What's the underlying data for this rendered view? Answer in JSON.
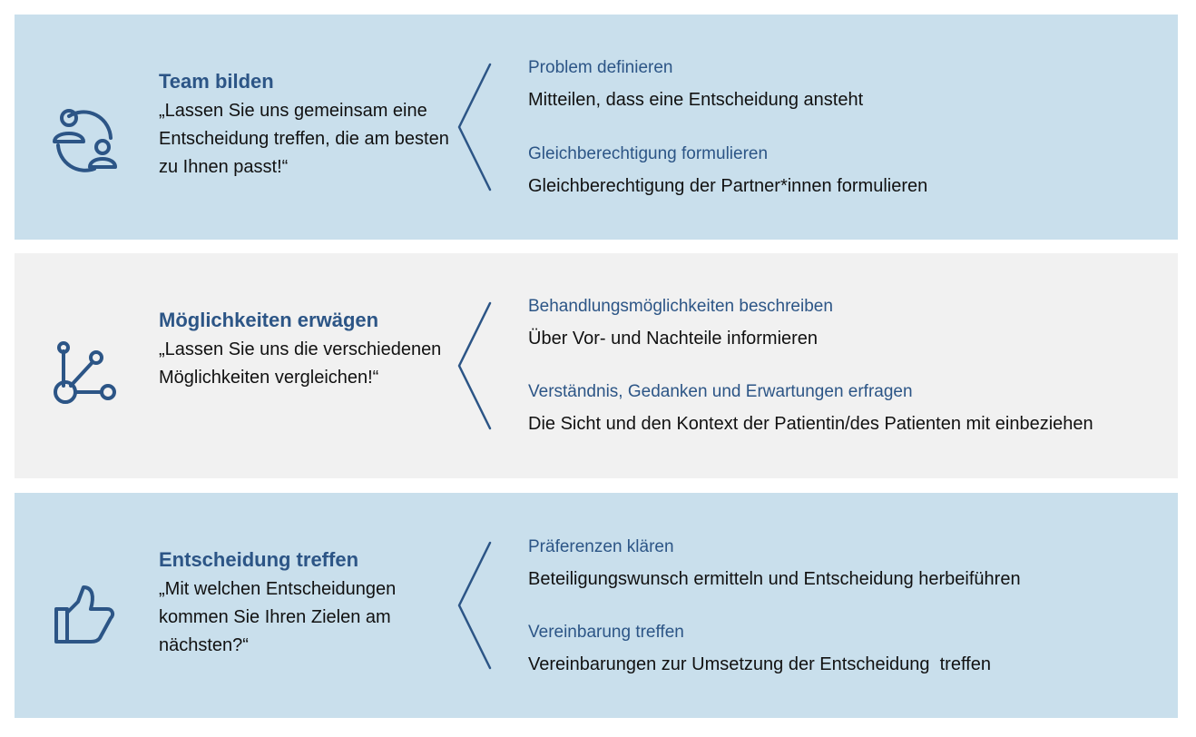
{
  "colors": {
    "panel_blue": "#c9dfec",
    "panel_gray": "#f1f1f1",
    "accent_navy": "#2c5586",
    "body_text": "#111111"
  },
  "sections": [
    {
      "icon": "team-people-icon",
      "title": "Team bilden",
      "quote": "„Lassen Sie uns gemeinsam eine Entscheidung treffen, die am besten zu Ihnen passt!“",
      "items": [
        {
          "heading": "Problem definieren",
          "description": "Mitteilen, dass eine Entscheidung ansteht"
        },
        {
          "heading": "Gleichberechtigung formulieren",
          "description": "Gleichberechtigung der Partner*innen formulieren"
        }
      ]
    },
    {
      "icon": "branching-nodes-icon",
      "title": "Möglichkeiten erwägen",
      "quote": "„Lassen Sie uns die verschiedenen Möglichkeiten vergleichen!“",
      "items": [
        {
          "heading": "Behandlungsmöglichkeiten beschreiben",
          "description": "Über Vor- und Nachteile informieren"
        },
        {
          "heading": "Verständnis, Gedanken und Erwartungen erfragen",
          "description": "Die Sicht und den Kontext der Patientin/des Patienten mit einbeziehen"
        }
      ]
    },
    {
      "icon": "thumbs-up-icon",
      "title": "Entscheidung treffen",
      "quote": "„Mit welchen Entscheidungen kommen Sie Ihren Zielen am nächsten?“",
      "items": [
        {
          "heading": "Präferenzen klären",
          "description": "Beteiligungswunsch ermitteln und Entscheidung herbeiführen"
        },
        {
          "heading": "Vereinbarung treffen",
          "description": "Vereinbarungen zur Umsetzung der Entscheidung  treffen"
        }
      ]
    }
  ]
}
